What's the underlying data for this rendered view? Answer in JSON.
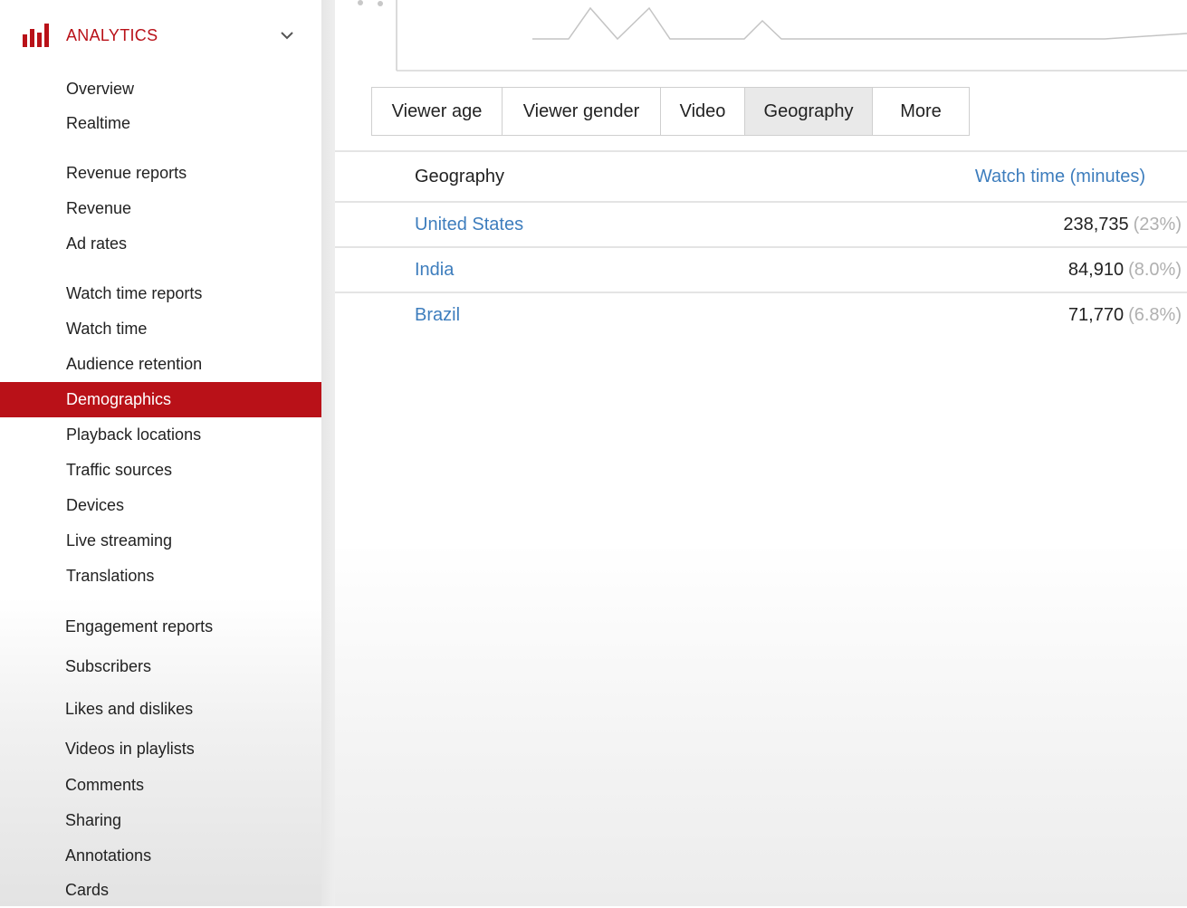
{
  "sidebar": {
    "title": "ANALYTICS",
    "icon": "analytics-bar-chart-icon",
    "accent_color": "#b91118",
    "items": [
      {
        "label": "Overview"
      },
      {
        "label": "Realtime"
      },
      {
        "label": "Revenue reports"
      },
      {
        "label": "Revenue"
      },
      {
        "label": "Ad rates"
      },
      {
        "label": "Watch time reports"
      },
      {
        "label": "Watch time"
      },
      {
        "label": "Audience retention"
      },
      {
        "label": "Demographics",
        "active": true
      },
      {
        "label": "Playback locations"
      },
      {
        "label": "Traffic sources"
      },
      {
        "label": "Devices"
      },
      {
        "label": "Live streaming"
      },
      {
        "label": "Translations"
      },
      {
        "label": "Engagement reports"
      },
      {
        "label": "Subscribers"
      },
      {
        "label": "Likes and dislikes"
      },
      {
        "label": "Videos in playlists"
      },
      {
        "label": "Comments"
      },
      {
        "label": "Sharing"
      },
      {
        "label": "Annotations"
      },
      {
        "label": "Cards"
      }
    ]
  },
  "main": {
    "tabs": [
      {
        "label": "Viewer age"
      },
      {
        "label": "Viewer gender"
      },
      {
        "label": "Video"
      },
      {
        "label": "Geography",
        "selected": true
      },
      {
        "label": "More"
      }
    ],
    "table": {
      "headers": {
        "dimension": "Geography",
        "metric": "Watch time (minutes)"
      },
      "rows": [
        {
          "name": "United States",
          "value": "238,735",
          "percent": "(23%)"
        },
        {
          "name": "India",
          "value": "84,910",
          "percent": "(8.0%)"
        },
        {
          "name": "Brazil",
          "value": "71,770",
          "percent": "(6.8%)"
        }
      ]
    },
    "link_color": "#3d7dbd"
  }
}
